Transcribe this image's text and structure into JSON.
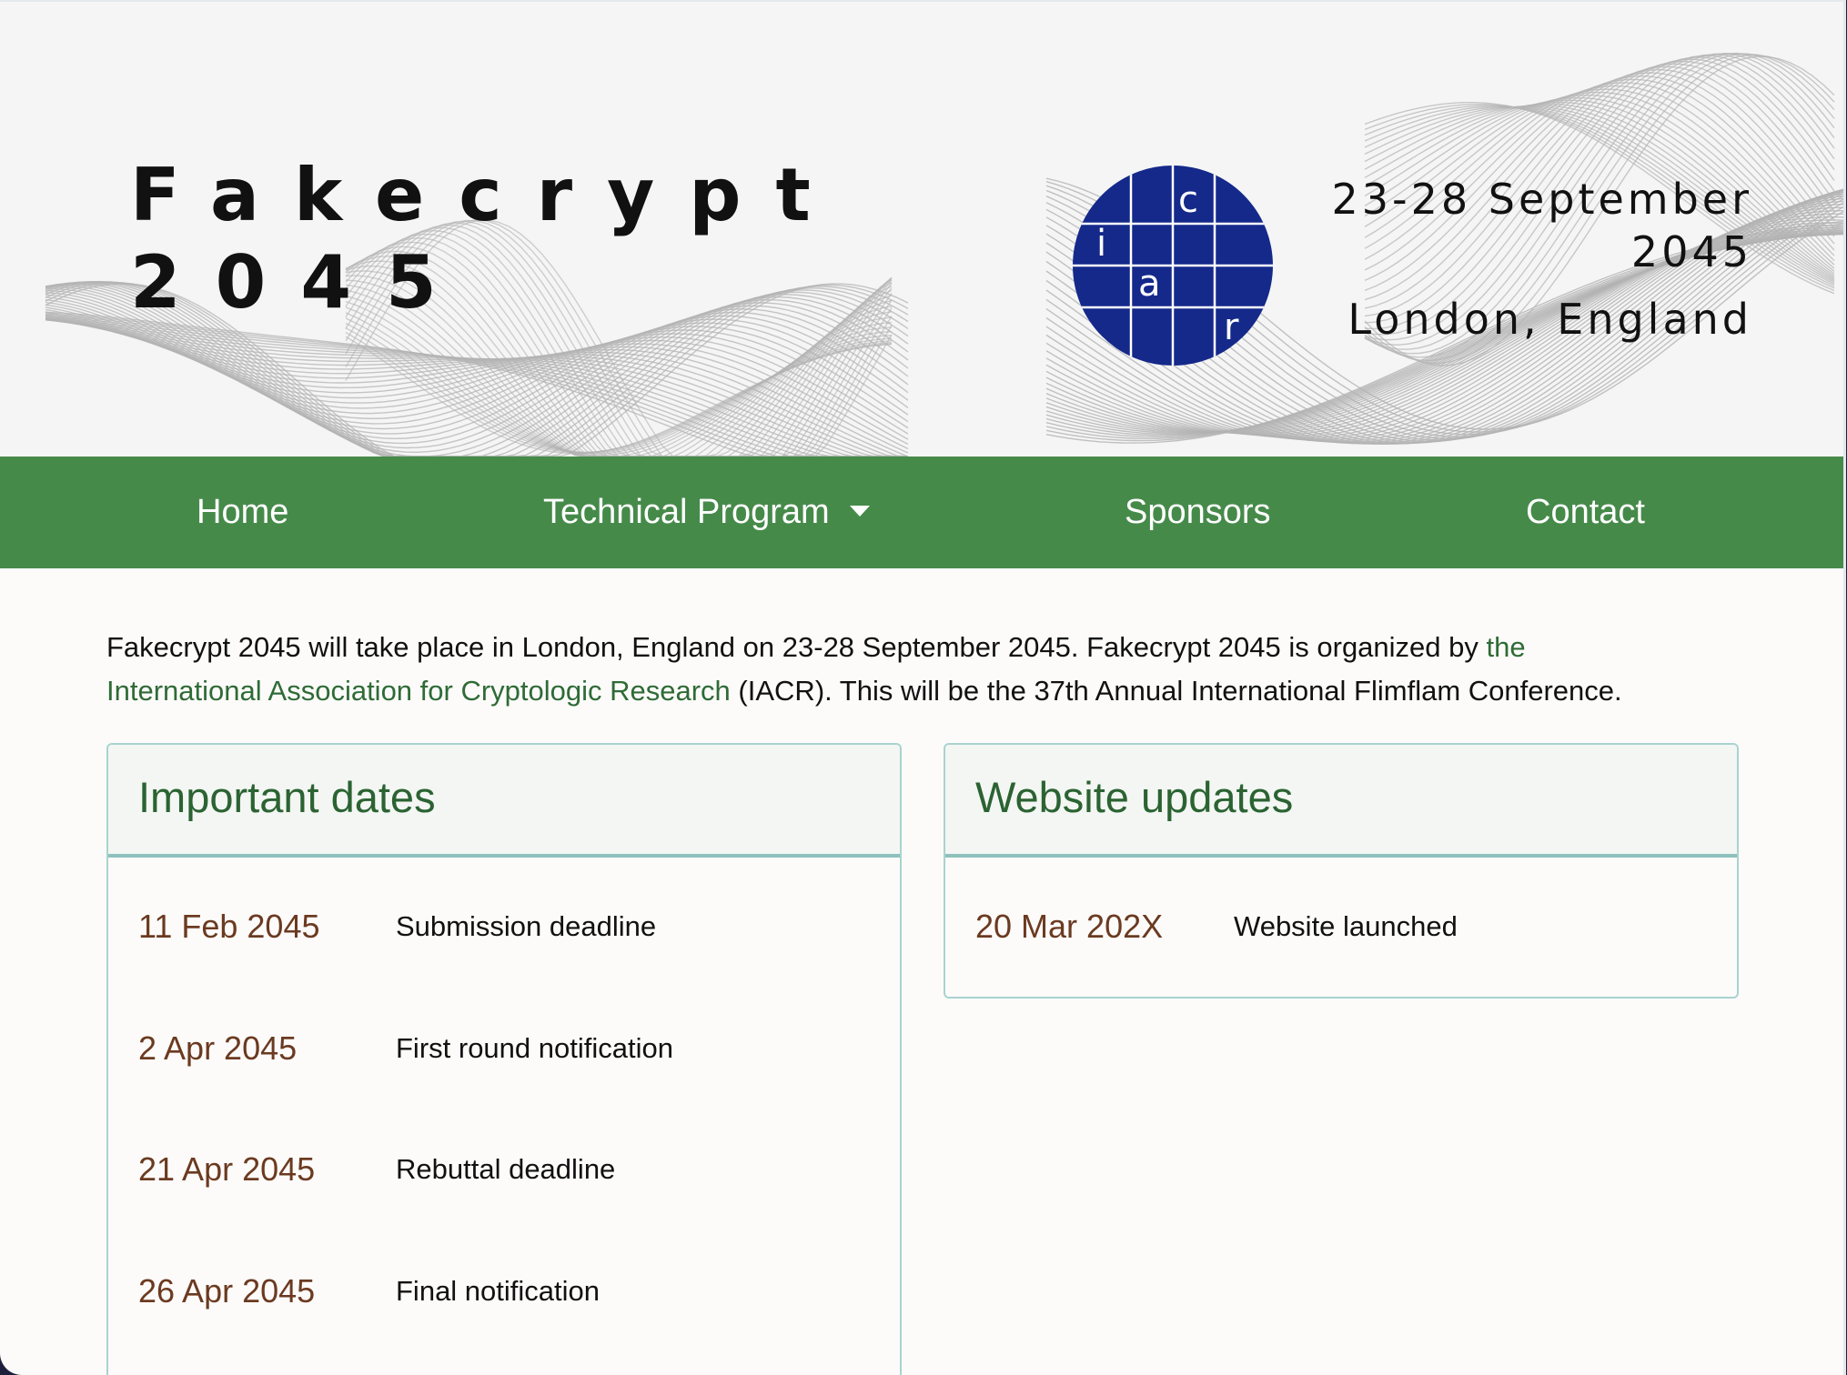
{
  "header": {
    "title_line1": "Fakecrypt",
    "title_line2": "2045",
    "dates_line1": "23-28 September",
    "dates_line2": "2045",
    "location": "London, England",
    "logo_letters": [
      "c",
      "i",
      "a",
      "r"
    ],
    "logo_color": "#14298a"
  },
  "nav": {
    "home": "Home",
    "program": "Technical Program",
    "sponsors": "Sponsors",
    "contact": "Contact",
    "color": "#468a4a"
  },
  "intro": {
    "text_before": "Fakecrypt 2045 will take place in London, England on 23-28 September 2045. Fakecrypt 2045 is organized by ",
    "link_part1": "the",
    "link_part2": "International Association for Cryptologic Research",
    "text_after": " (IACR). This will be the 37th Annual International Flimflam Conference."
  },
  "important_dates": {
    "title": "Important dates",
    "rows": [
      {
        "date": "11 Feb 2045",
        "desc": "Submission deadline"
      },
      {
        "date": "2 Apr 2045",
        "desc": "First round notification"
      },
      {
        "date": "21 Apr 2045",
        "desc": "Rebuttal deadline"
      },
      {
        "date": "26 Apr 2045",
        "desc": "Final notification"
      }
    ]
  },
  "website_updates": {
    "title": "Website updates",
    "rows": [
      {
        "date": "20 Mar 202X",
        "desc": "Website launched"
      }
    ]
  }
}
